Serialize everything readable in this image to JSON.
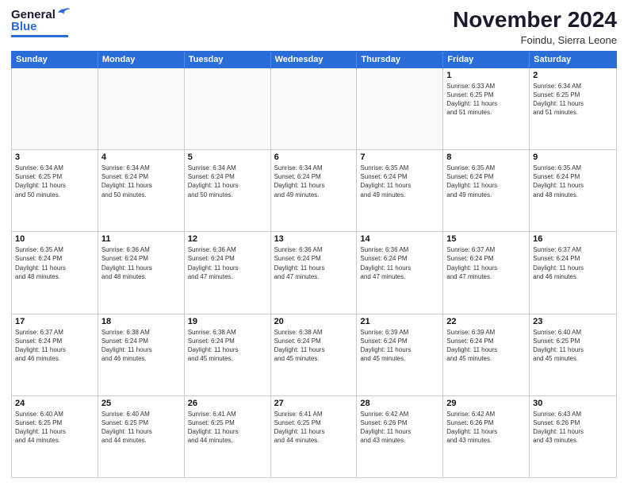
{
  "header": {
    "logo_general": "General",
    "logo_blue": "Blue",
    "month_title": "November 2024",
    "location": "Foindu, Sierra Leone"
  },
  "days_of_week": [
    "Sunday",
    "Monday",
    "Tuesday",
    "Wednesday",
    "Thursday",
    "Friday",
    "Saturday"
  ],
  "weeks": [
    [
      {
        "day": "",
        "info": "",
        "empty": true
      },
      {
        "day": "",
        "info": "",
        "empty": true
      },
      {
        "day": "",
        "info": "",
        "empty": true
      },
      {
        "day": "",
        "info": "",
        "empty": true
      },
      {
        "day": "",
        "info": "",
        "empty": true
      },
      {
        "day": "1",
        "info": "Sunrise: 6:33 AM\nSunset: 6:25 PM\nDaylight: 11 hours\nand 51 minutes.",
        "empty": false
      },
      {
        "day": "2",
        "info": "Sunrise: 6:34 AM\nSunset: 6:25 PM\nDaylight: 11 hours\nand 51 minutes.",
        "empty": false
      }
    ],
    [
      {
        "day": "3",
        "info": "Sunrise: 6:34 AM\nSunset: 6:25 PM\nDaylight: 11 hours\nand 50 minutes.",
        "empty": false
      },
      {
        "day": "4",
        "info": "Sunrise: 6:34 AM\nSunset: 6:24 PM\nDaylight: 11 hours\nand 50 minutes.",
        "empty": false
      },
      {
        "day": "5",
        "info": "Sunrise: 6:34 AM\nSunset: 6:24 PM\nDaylight: 11 hours\nand 50 minutes.",
        "empty": false
      },
      {
        "day": "6",
        "info": "Sunrise: 6:34 AM\nSunset: 6:24 PM\nDaylight: 11 hours\nand 49 minutes.",
        "empty": false
      },
      {
        "day": "7",
        "info": "Sunrise: 6:35 AM\nSunset: 6:24 PM\nDaylight: 11 hours\nand 49 minutes.",
        "empty": false
      },
      {
        "day": "8",
        "info": "Sunrise: 6:35 AM\nSunset: 6:24 PM\nDaylight: 11 hours\nand 49 minutes.",
        "empty": false
      },
      {
        "day": "9",
        "info": "Sunrise: 6:35 AM\nSunset: 6:24 PM\nDaylight: 11 hours\nand 48 minutes.",
        "empty": false
      }
    ],
    [
      {
        "day": "10",
        "info": "Sunrise: 6:35 AM\nSunset: 6:24 PM\nDaylight: 11 hours\nand 48 minutes.",
        "empty": false
      },
      {
        "day": "11",
        "info": "Sunrise: 6:36 AM\nSunset: 6:24 PM\nDaylight: 11 hours\nand 48 minutes.",
        "empty": false
      },
      {
        "day": "12",
        "info": "Sunrise: 6:36 AM\nSunset: 6:24 PM\nDaylight: 11 hours\nand 47 minutes.",
        "empty": false
      },
      {
        "day": "13",
        "info": "Sunrise: 6:36 AM\nSunset: 6:24 PM\nDaylight: 11 hours\nand 47 minutes.",
        "empty": false
      },
      {
        "day": "14",
        "info": "Sunrise: 6:36 AM\nSunset: 6:24 PM\nDaylight: 11 hours\nand 47 minutes.",
        "empty": false
      },
      {
        "day": "15",
        "info": "Sunrise: 6:37 AM\nSunset: 6:24 PM\nDaylight: 11 hours\nand 47 minutes.",
        "empty": false
      },
      {
        "day": "16",
        "info": "Sunrise: 6:37 AM\nSunset: 6:24 PM\nDaylight: 11 hours\nand 46 minutes.",
        "empty": false
      }
    ],
    [
      {
        "day": "17",
        "info": "Sunrise: 6:37 AM\nSunset: 6:24 PM\nDaylight: 11 hours\nand 46 minutes.",
        "empty": false
      },
      {
        "day": "18",
        "info": "Sunrise: 6:38 AM\nSunset: 6:24 PM\nDaylight: 11 hours\nand 46 minutes.",
        "empty": false
      },
      {
        "day": "19",
        "info": "Sunrise: 6:38 AM\nSunset: 6:24 PM\nDaylight: 11 hours\nand 45 minutes.",
        "empty": false
      },
      {
        "day": "20",
        "info": "Sunrise: 6:38 AM\nSunset: 6:24 PM\nDaylight: 11 hours\nand 45 minutes.",
        "empty": false
      },
      {
        "day": "21",
        "info": "Sunrise: 6:39 AM\nSunset: 6:24 PM\nDaylight: 11 hours\nand 45 minutes.",
        "empty": false
      },
      {
        "day": "22",
        "info": "Sunrise: 6:39 AM\nSunset: 6:24 PM\nDaylight: 11 hours\nand 45 minutes.",
        "empty": false
      },
      {
        "day": "23",
        "info": "Sunrise: 6:40 AM\nSunset: 6:25 PM\nDaylight: 11 hours\nand 45 minutes.",
        "empty": false
      }
    ],
    [
      {
        "day": "24",
        "info": "Sunrise: 6:40 AM\nSunset: 6:25 PM\nDaylight: 11 hours\nand 44 minutes.",
        "empty": false
      },
      {
        "day": "25",
        "info": "Sunrise: 6:40 AM\nSunset: 6:25 PM\nDaylight: 11 hours\nand 44 minutes.",
        "empty": false
      },
      {
        "day": "26",
        "info": "Sunrise: 6:41 AM\nSunset: 6:25 PM\nDaylight: 11 hours\nand 44 minutes.",
        "empty": false
      },
      {
        "day": "27",
        "info": "Sunrise: 6:41 AM\nSunset: 6:25 PM\nDaylight: 11 hours\nand 44 minutes.",
        "empty": false
      },
      {
        "day": "28",
        "info": "Sunrise: 6:42 AM\nSunset: 6:26 PM\nDaylight: 11 hours\nand 43 minutes.",
        "empty": false
      },
      {
        "day": "29",
        "info": "Sunrise: 6:42 AM\nSunset: 6:26 PM\nDaylight: 11 hours\nand 43 minutes.",
        "empty": false
      },
      {
        "day": "30",
        "info": "Sunrise: 6:43 AM\nSunset: 6:26 PM\nDaylight: 11 hours\nand 43 minutes.",
        "empty": false
      }
    ]
  ]
}
